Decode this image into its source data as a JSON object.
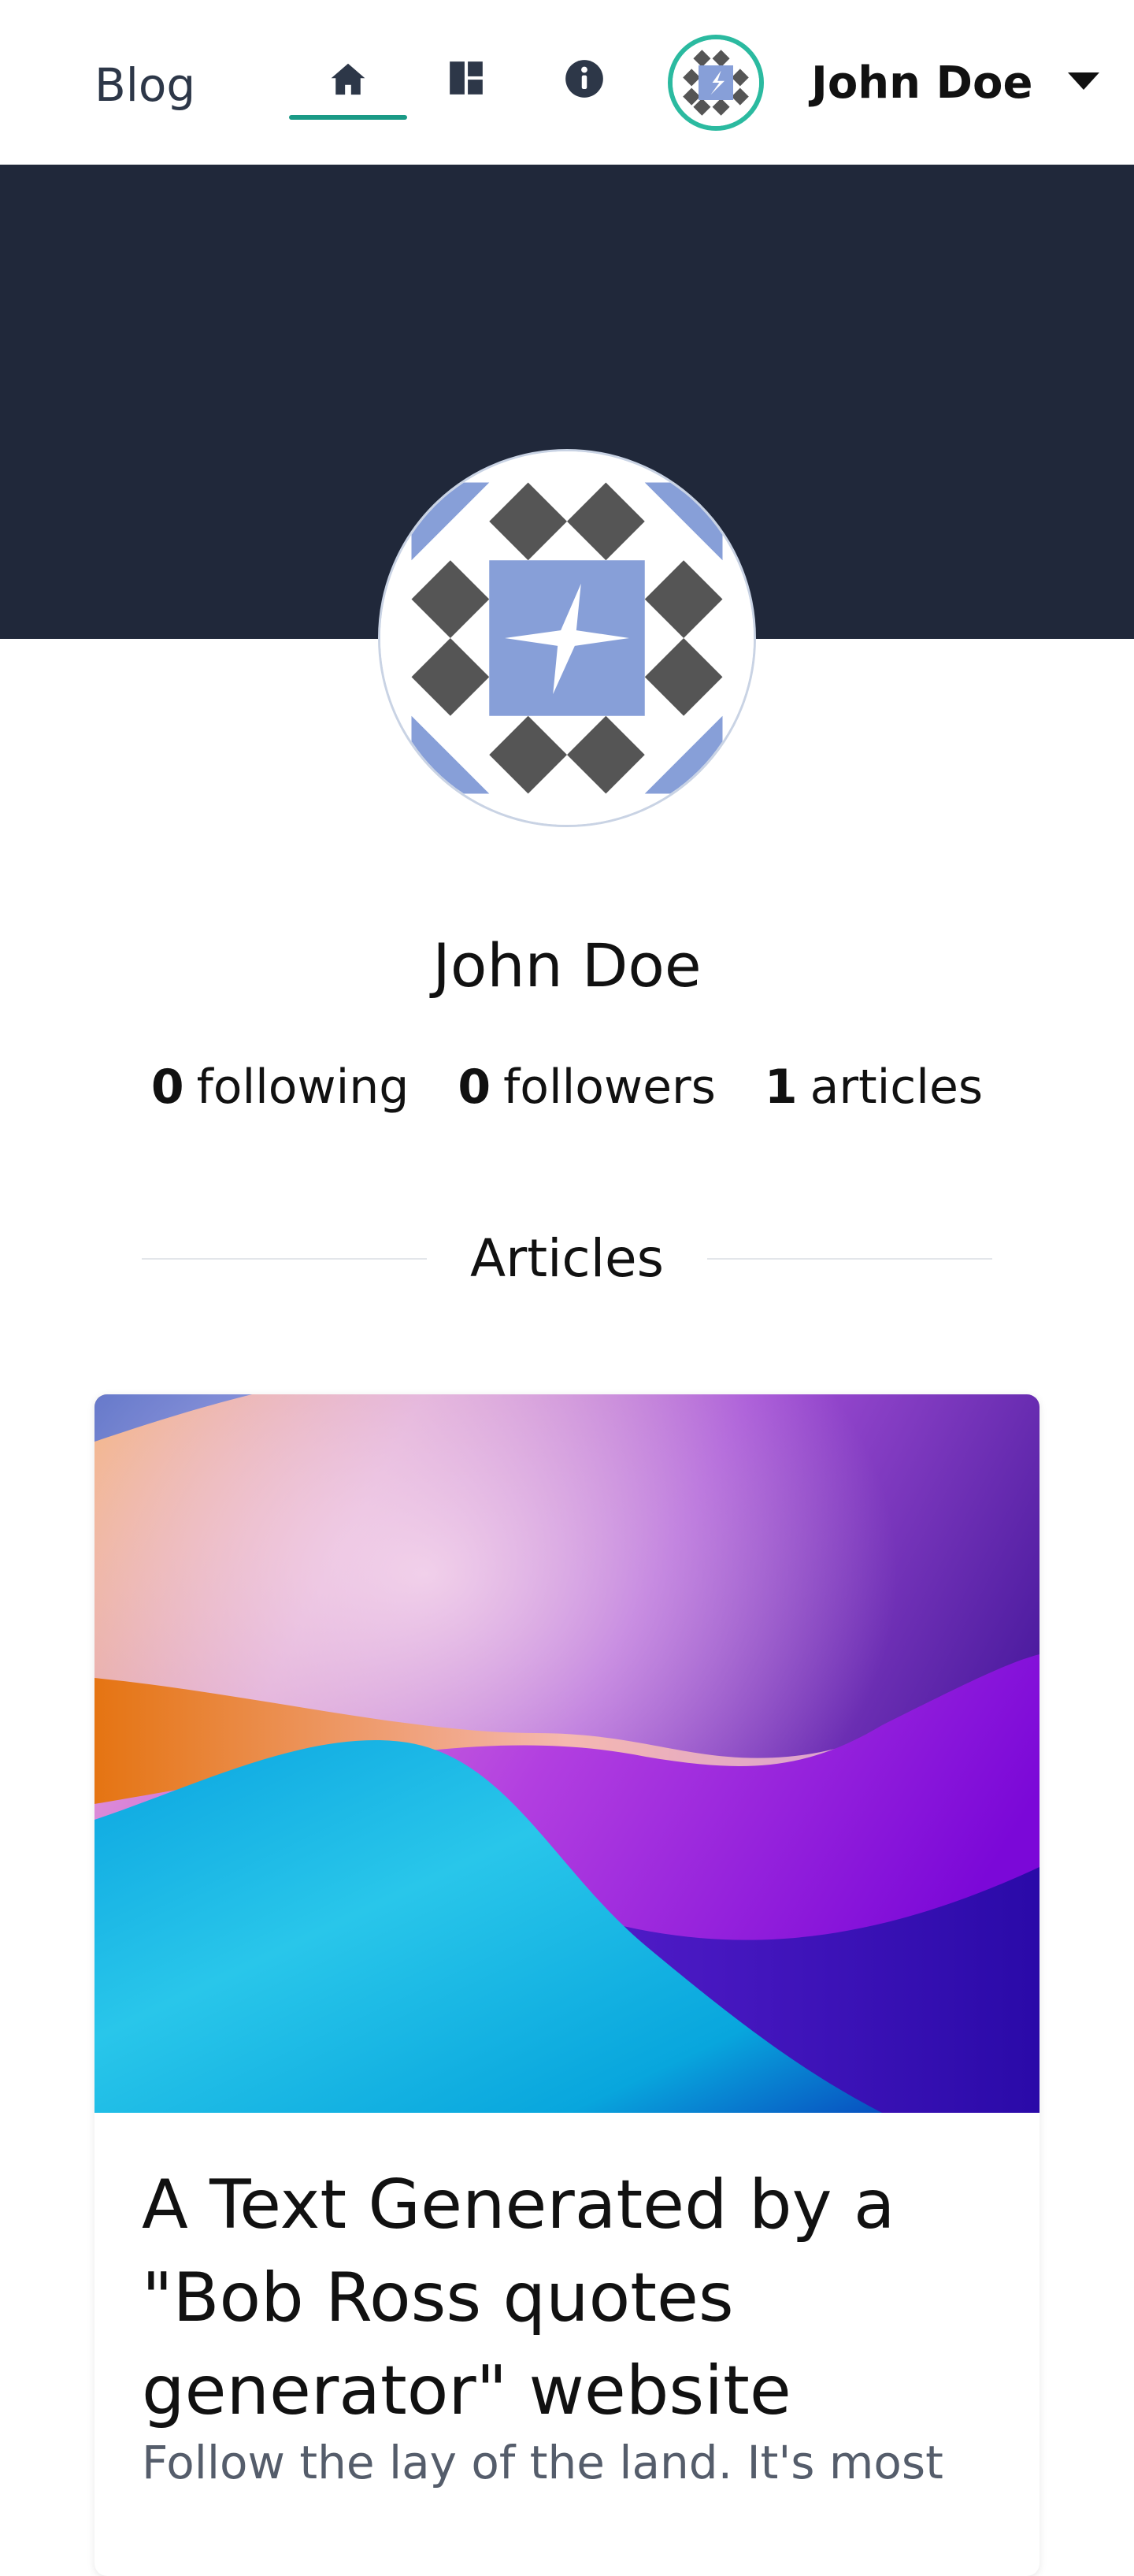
{
  "header": {
    "brand": "Blog",
    "nav": [
      {
        "name": "home",
        "icon": "home-icon",
        "active": true
      },
      {
        "name": "dashboard",
        "icon": "dashboard-icon",
        "active": false
      },
      {
        "name": "about",
        "icon": "info-icon",
        "active": false
      }
    ],
    "user": {
      "name": "John Doe",
      "avatar_icon": "identicon-avatar",
      "menu_icon": "caret-down-icon"
    }
  },
  "profile": {
    "name": "John Doe",
    "stats": {
      "following_count": "0",
      "following_label": "following",
      "followers_count": "0",
      "followers_label": "followers",
      "articles_count": "1",
      "articles_label": "articles"
    }
  },
  "articles_section": {
    "title": "Articles",
    "items": [
      {
        "title": "A Text Generated by a \"Bob Ross quotes generator\" website",
        "excerpt": "Follow the lay of the land. It's most",
        "cover_icon": "abstract-wave-cover"
      }
    ]
  },
  "colors": {
    "hero_background": "#20283a",
    "accent": "#1a9a86",
    "avatar_ring": "#2bbaa0",
    "identicon_blue": "#879fd8",
    "identicon_gray": "#555555"
  }
}
